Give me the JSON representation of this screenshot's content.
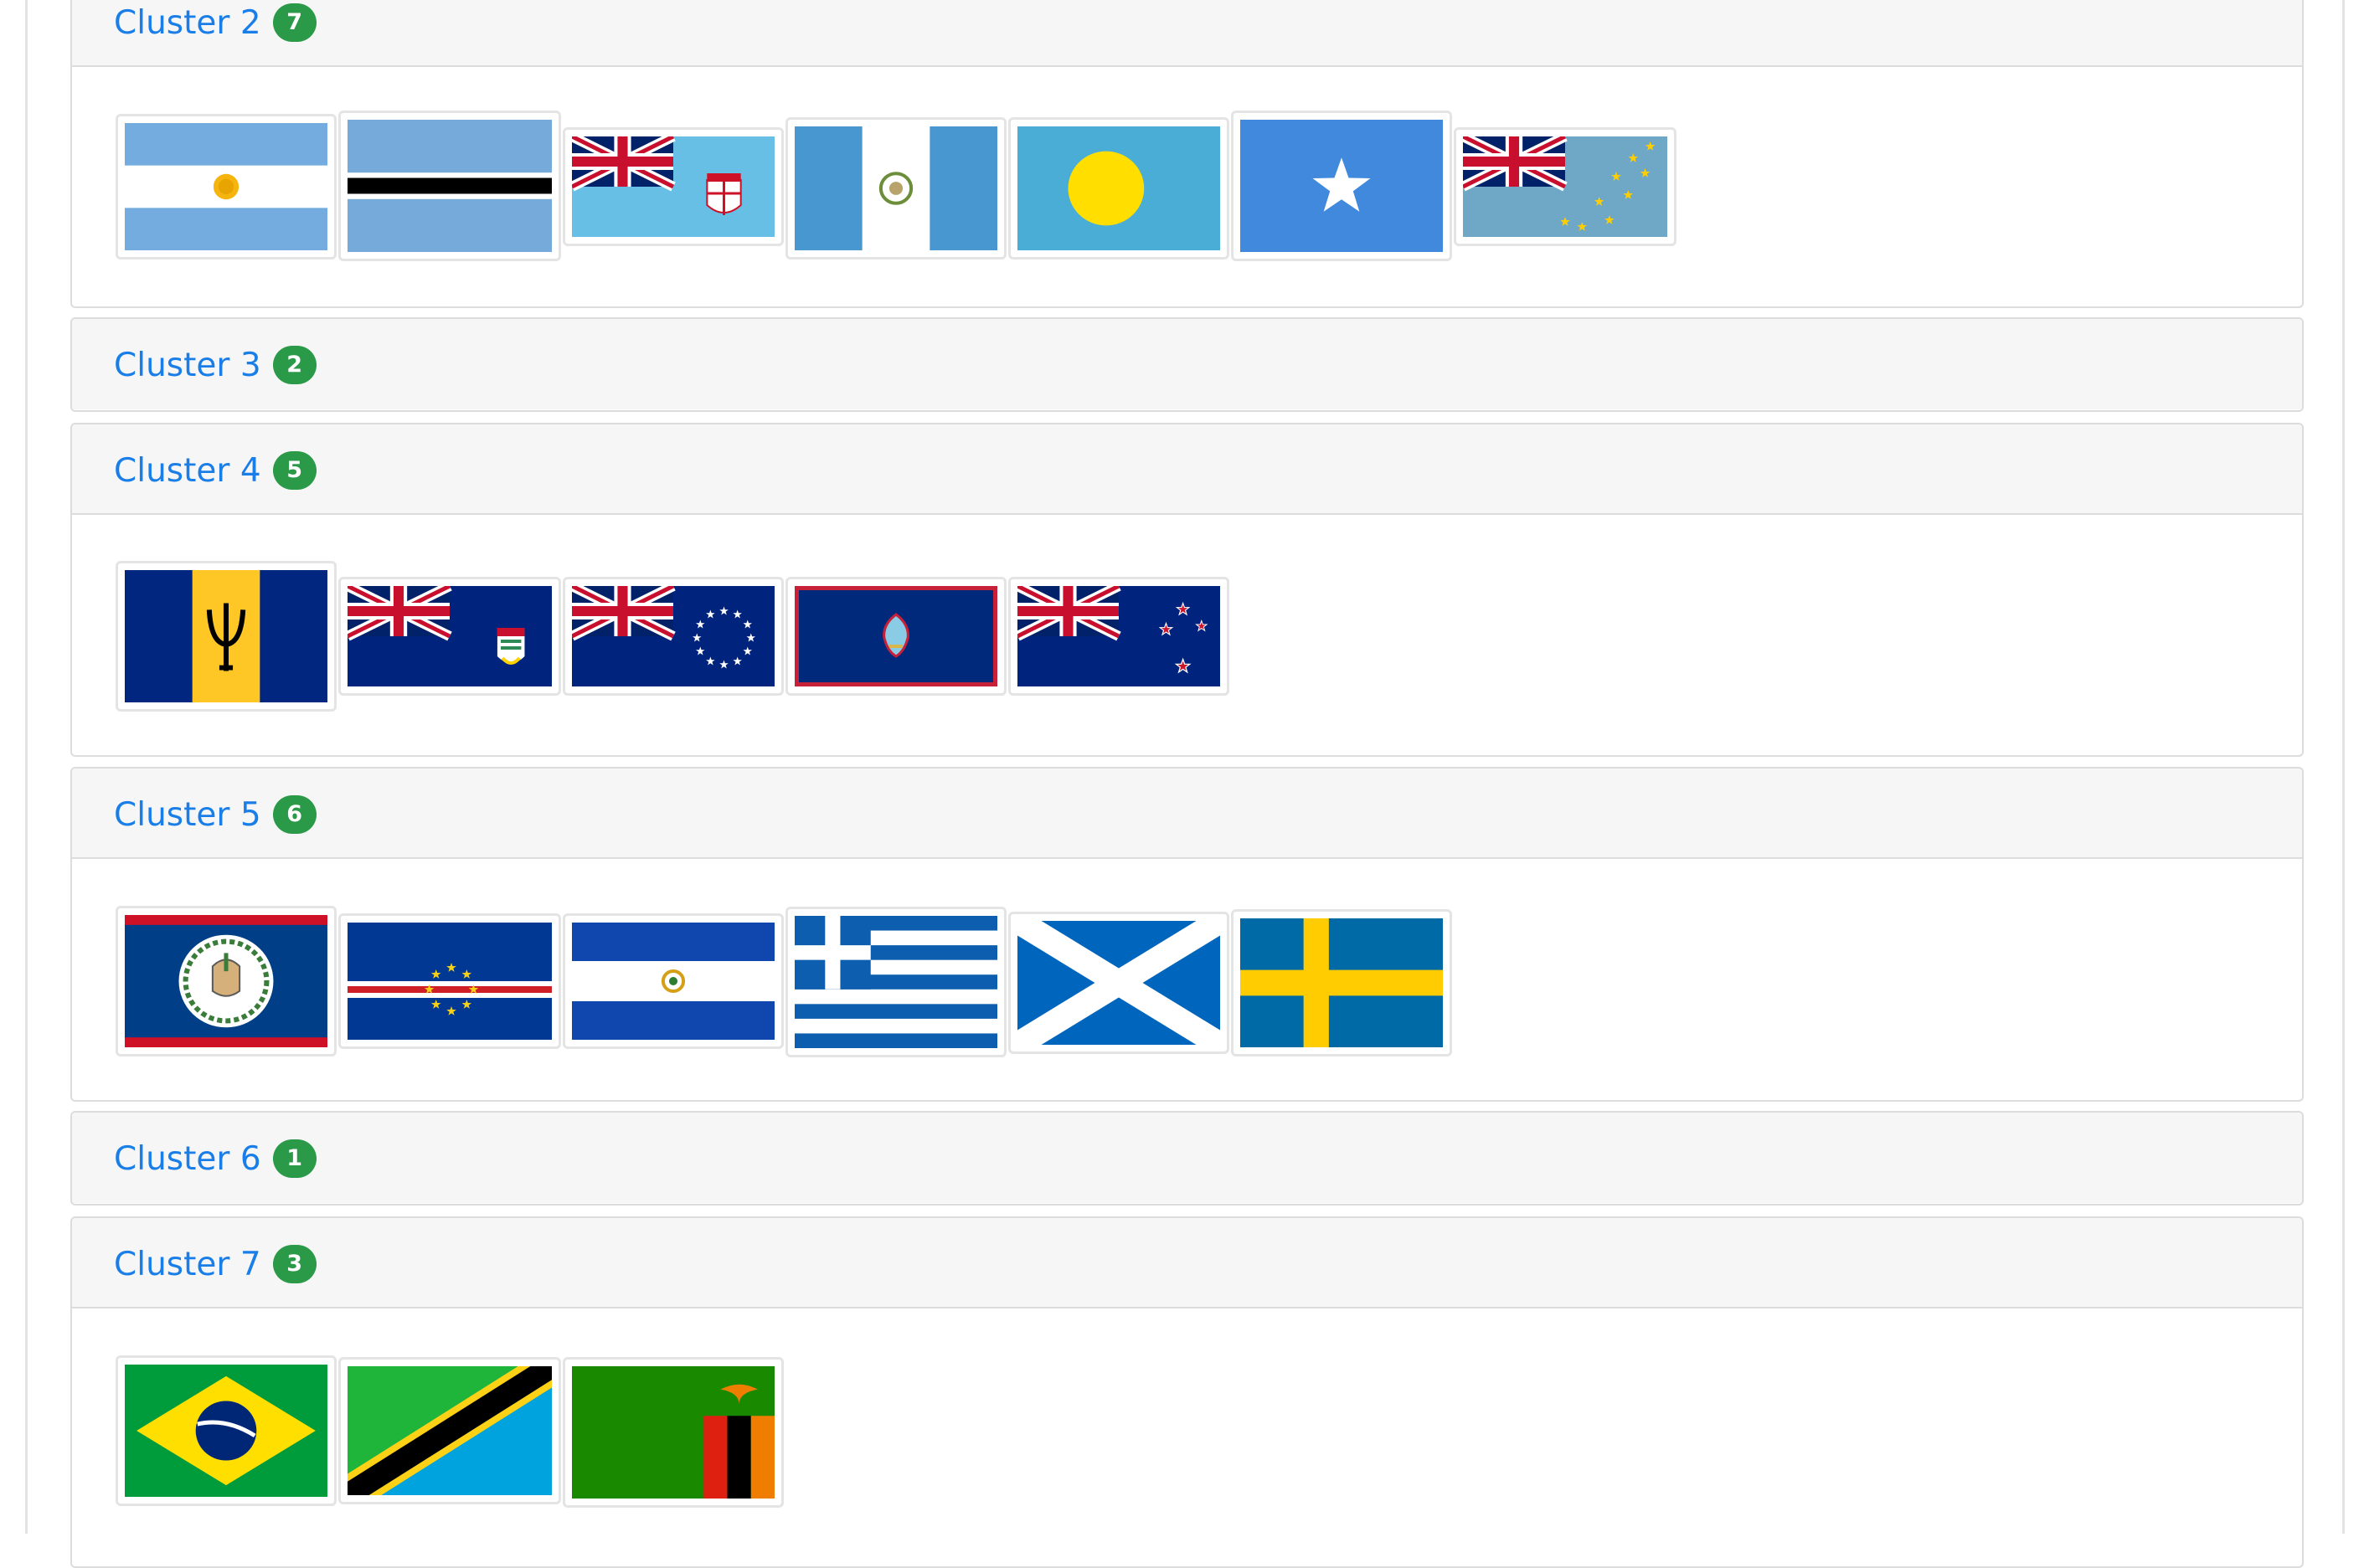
{
  "clusters": [
    {
      "label": "Cluster 2",
      "count": "7"
    },
    {
      "label": "Cluster 3",
      "count": "2"
    },
    {
      "label": "Cluster 4",
      "count": "5"
    },
    {
      "label": "Cluster 5",
      "count": "6"
    },
    {
      "label": "Cluster 6",
      "count": "1"
    },
    {
      "label": "Cluster 7",
      "count": "3"
    }
  ],
  "colors": {
    "link": "#1a7ee8",
    "badge": "#2a9a48",
    "header_bg": "#f6f6f6",
    "border": "#dcdcdc"
  },
  "flag_icons": {
    "cluster2": [
      "argentina-flag-icon",
      "botswana-flag-icon",
      "fiji-flag-icon",
      "guatemala-flag-icon",
      "palau-flag-icon",
      "somalia-flag-icon",
      "tuvalu-flag-icon"
    ],
    "cluster4": [
      "barbados-flag-icon",
      "cayman-islands-flag-icon",
      "cook-islands-flag-icon",
      "guam-flag-icon",
      "new-zealand-flag-icon"
    ],
    "cluster5": [
      "belize-flag-icon",
      "cape-verde-flag-icon",
      "el-salvador-flag-icon",
      "greece-flag-icon",
      "scotland-flag-icon",
      "sweden-flag-icon"
    ],
    "cluster7": [
      "brazil-flag-icon",
      "tanzania-flag-icon",
      "zambia-flag-icon"
    ]
  }
}
